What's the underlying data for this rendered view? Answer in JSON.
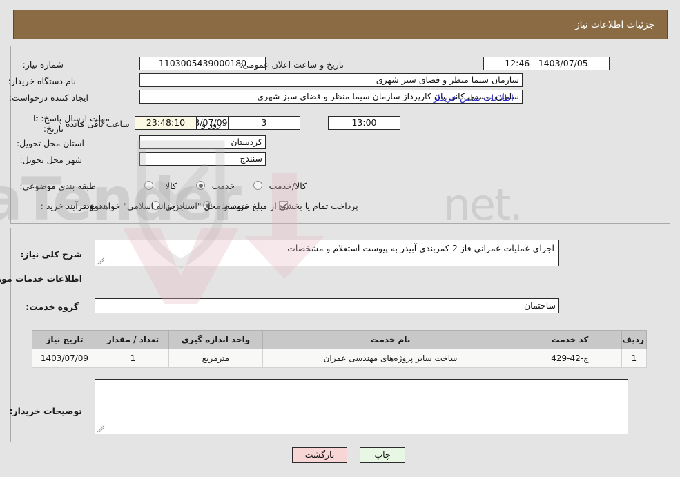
{
  "header": {
    "title": "جزئیات اطلاعات نیاز",
    "bar_color": "#8b6b43"
  },
  "top_form": {
    "need_number_label": "شماره نیاز:",
    "need_number_value": "1103005439000180",
    "announce_datetime_label": "تاریخ و ساعت اعلان عمومی:",
    "announce_datetime_value": "1403/07/05 - 12:46",
    "buyer_org_label": "نام دستگاه خریدار:",
    "buyer_org_value": "سازمان سیما  منظر و فضای سبز شهری",
    "creator_label": "ایجاد کننده درخواست:",
    "creator_value": "سامان یوسفی کانی بان کارپرداز سازمان سیما  منظر و فضای سبز شهری",
    "contact_link": "اطلاعات تماس خریدار",
    "deadline_label_line1": "مهلت ارسال پاسخ: تا",
    "deadline_label_line2": "تاریخ:",
    "deadline_date_value": "1403/07/09",
    "deadline_hour_label": "ساعت",
    "deadline_hour_value": "13:00",
    "days_value": "3",
    "days_word": "روز و",
    "countdown_value": "23:48:10",
    "remaining_label": "ساعت باقی مانده",
    "province_label": "استان محل تحویل:",
    "province_value": "کردستان",
    "city_label": "شهر محل تحویل:",
    "city_value": "سنندج",
    "category_label": "طبقه بندی موضوعی:",
    "category_options": [
      {
        "label": "کالا",
        "selected": false
      },
      {
        "label": "خدمت",
        "selected": true
      },
      {
        "label": "کالا/خدمت",
        "selected": false
      }
    ],
    "process_label": "نوع فرآیند خرید :",
    "process_options": [
      {
        "label": "جزیی",
        "selected": false
      },
      {
        "label": "متوسط",
        "selected": true
      }
    ],
    "treasury_checkbox_checked": true,
    "treasury_note": "پرداخت تمام یا بخشی از مبلغ خرید،از محل \"اسناد خزانه اسلامی\" خواهد بود."
  },
  "bottom_form": {
    "summary_label": "شرح کلی نیاز:",
    "summary_value": "اجرای عملیات عمرانی فاز 2 کمربندی آبیدر به پیوست استعلام و مشخصات",
    "services_heading": "اطلاعات خدمات مورد نیاز",
    "service_group_label": "گروه خدمت:",
    "service_group_value": "ساختمان",
    "buyer_notes_label": "توضیحات خریدار:",
    "buyer_notes_value": ""
  },
  "table": {
    "columns": [
      "ردیف",
      "کد خدمت",
      "نام خدمت",
      "واحد اندازه گیری",
      "تعداد / مقدار",
      "تاریخ نیاز"
    ],
    "rows": [
      {
        "row": "1",
        "code": "ج-42-429",
        "name": "ساخت سایر پروژه‌های مهندسی عمران",
        "unit": "مترمربع",
        "qty": "1",
        "date": "1403/07/09"
      }
    ]
  },
  "footer": {
    "print_label": "چاپ",
    "back_label": "بازگشت"
  },
  "watermark": {
    "text": "AriaTender.net",
    "shield_color": "#c8c8c8",
    "arrow_color": "#e8c6cc"
  }
}
